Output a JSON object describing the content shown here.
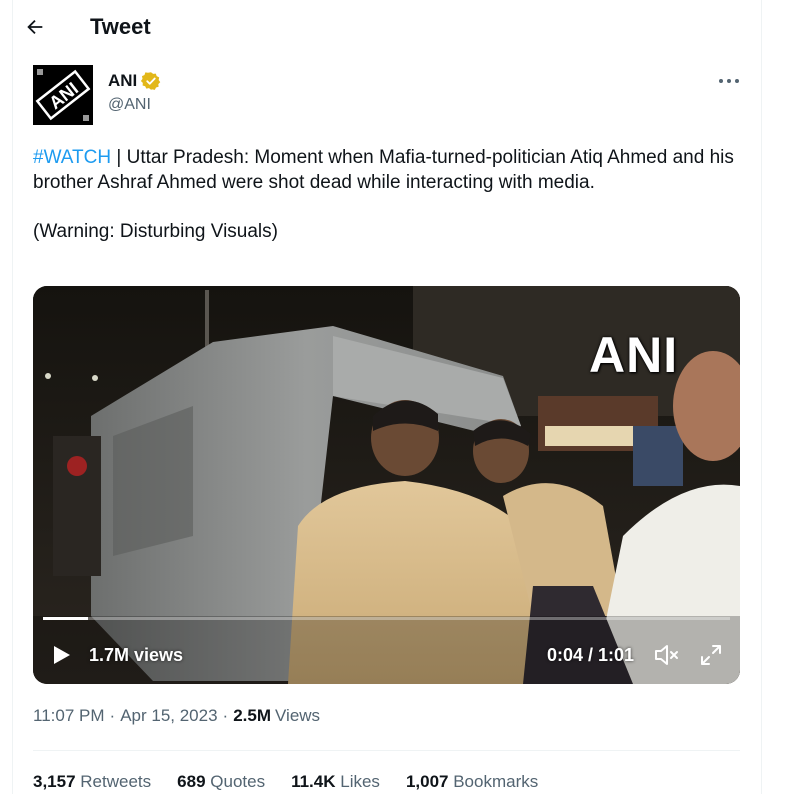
{
  "header": {
    "title": "Tweet"
  },
  "author": {
    "name": "ANI",
    "handle": "@ANI",
    "avatar_text": "ANI"
  },
  "tweet": {
    "hashtag": "#WATCH",
    "separator": " | ",
    "body": "Uttar Pradesh: Moment when Mafia-turned-politician Atiq Ahmed and his brother Ashraf Ahmed were shot dead while interacting with media.",
    "warning": "(Warning: Disturbing Visuals)"
  },
  "video": {
    "watermark": "ANI",
    "views": "1.7M views",
    "time": "0:04 / 1:01",
    "progress": 0.066
  },
  "meta": {
    "time": "11:07 PM",
    "dot": "·",
    "date": "Apr 15, 2023",
    "views_count": "2.5M",
    "views_label": "Views"
  },
  "stats": [
    {
      "count": "3,157",
      "label": "Retweets"
    },
    {
      "count": "689",
      "label": "Quotes"
    },
    {
      "count": "11.4K",
      "label": "Likes"
    },
    {
      "count": "1,007",
      "label": "Bookmarks"
    }
  ],
  "colors": {
    "accent": "#1d9bf0",
    "secondary_text": "#536471",
    "verified_gold": "#e2b719"
  },
  "icons": [
    "back-arrow-icon",
    "verified-badge-icon",
    "more-icon",
    "play-icon",
    "mute-icon",
    "fullscreen-icon"
  ]
}
